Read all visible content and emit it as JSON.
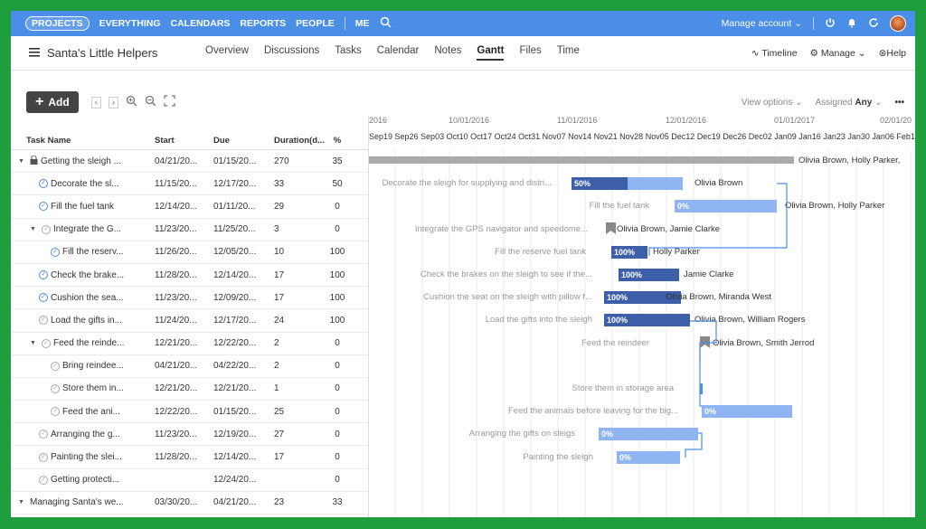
{
  "topnav": {
    "items": [
      "PROJECTS",
      "EVERYTHING",
      "CALENDARS",
      "REPORTS",
      "PEOPLE"
    ],
    "me": "ME",
    "manage_account": "Manage account"
  },
  "project": {
    "title": "Santa's Little Helpers",
    "tabs": [
      "Overview",
      "Discussions",
      "Tasks",
      "Calendar",
      "Notes",
      "Gantt",
      "Files",
      "Time"
    ],
    "active_tab": "Gantt",
    "timeline": "Timeline",
    "manage": "Manage",
    "help": "Help"
  },
  "toolbar": {
    "add_label": "Add",
    "view_options": "View options",
    "assigned_label": "Assigned",
    "assigned_value": "Any"
  },
  "table": {
    "headers": [
      "Task Name",
      "Start",
      "Due",
      "Duration(d...",
      "%"
    ],
    "rows": [
      {
        "name": "Getting the sleigh ...",
        "start": "04/21/20...",
        "due": "01/15/20...",
        "dur": "270",
        "pct": "35"
      },
      {
        "name": "Decorate the sl...",
        "start": "11/15/20...",
        "due": "12/17/20...",
        "dur": "33",
        "pct": "50"
      },
      {
        "name": "Fill the fuel tank",
        "start": "12/14/20...",
        "due": "01/11/20...",
        "dur": "29",
        "pct": "0"
      },
      {
        "name": "Integrate the G...",
        "start": "11/23/20...",
        "due": "11/25/20...",
        "dur": "3",
        "pct": "0"
      },
      {
        "name": "Fill the reserv...",
        "start": "11/26/20...",
        "due": "12/05/20...",
        "dur": "10",
        "pct": "100"
      },
      {
        "name": "Check the brake...",
        "start": "11/28/20...",
        "due": "12/14/20...",
        "dur": "17",
        "pct": "100"
      },
      {
        "name": "Cushion the sea...",
        "start": "11/23/20...",
        "due": "12/09/20...",
        "dur": "17",
        "pct": "100"
      },
      {
        "name": "Load the gifts in...",
        "start": "11/24/20...",
        "due": "12/17/20...",
        "dur": "24",
        "pct": "100"
      },
      {
        "name": "Feed the reinde...",
        "start": "12/21/20...",
        "due": "12/22/20...",
        "dur": "2",
        "pct": "0"
      },
      {
        "name": "Bring reindee...",
        "start": "04/21/20...",
        "due": "04/22/20...",
        "dur": "2",
        "pct": "0"
      },
      {
        "name": "Store them in...",
        "start": "12/21/20...",
        "due": "12/21/20...",
        "dur": "1",
        "pct": "0"
      },
      {
        "name": "Feed the ani...",
        "start": "12/22/20...",
        "due": "01/15/20...",
        "dur": "25",
        "pct": "0"
      },
      {
        "name": "Arranging the g...",
        "start": "11/23/20...",
        "due": "12/19/20...",
        "dur": "27",
        "pct": "0"
      },
      {
        "name": "Painting the slei...",
        "start": "11/28/20...",
        "due": "12/14/20...",
        "dur": "17",
        "pct": "0"
      },
      {
        "name": "Getting protecti...",
        "start": "",
        "due": "12/24/20...",
        "dur": "",
        "pct": "0"
      },
      {
        "name": "Managing Santa's we...",
        "start": "03/30/20...",
        "due": "04/21/20...",
        "dur": "23",
        "pct": "33"
      }
    ]
  },
  "gantt": {
    "months": [
      "2016",
      "10/01/2016",
      "11/01/2016",
      "12/01/2016",
      "01/01/2017",
      "02/01/20"
    ],
    "weeks": "Sep19 Sep26 Sep03 Oct10 Oct17 Oct24 Oct31 Nov07 Nov14 Nov21 Nov28 Nov05 Dec12 Dec19 Dec26 Dec02 Jan09 Jan16 Jan23 Jan30 Jan06 Feb1",
    "tasks": [
      {
        "label": "",
        "assignee": "Olivia Brown, Holly Parker,",
        "pct": ""
      },
      {
        "label": "Decorate the sleigh for supplying and distri...",
        "assignee": "Olivia Brown",
        "pct": "50%"
      },
      {
        "label": "Fill the fuel tank",
        "assignee": "Olivia Brown, Holly Parker",
        "pct": "0%"
      },
      {
        "label": "Integrate the GPS navigator and speedome...",
        "assignee": "Olivia Brown, Jamie Clarke",
        "pct": ""
      },
      {
        "label": "Fill the reserve fuel tank",
        "assignee": "Holly Parker",
        "pct": "100%"
      },
      {
        "label": "Check the brakes on the sleigh to see if the...",
        "assignee": "Jamie Clarke",
        "pct": "100%"
      },
      {
        "label": "Cushion the seat on the sleigh with pillow f...",
        "assignee": "Olivia Brown, Miranda West",
        "pct": "100%"
      },
      {
        "label": "Load the gifts into the sleigh",
        "assignee": "Olivia Brown, William Rogers",
        "pct": "100%"
      },
      {
        "label": "Feed the reindeer",
        "assignee": "Olivia Brown, Smith Jerrod",
        "pct": ""
      },
      {
        "label": "",
        "assignee": "",
        "pct": ""
      },
      {
        "label": "Store them in storage area",
        "assignee": "",
        "pct": ""
      },
      {
        "label": "Feed the animals before leaving for the big...",
        "assignee": "",
        "pct": "0%"
      },
      {
        "label": "Arranging the gifts on sleigs",
        "assignee": "",
        "pct": "0%"
      },
      {
        "label": "Painting the sleigh",
        "assignee": "",
        "pct": "0%"
      }
    ]
  },
  "colors": {
    "frame": "#1e9e3c",
    "topbar": "#4a8ee8",
    "bar_light": "#8fb4f2",
    "bar_dark": "#3c5fa8"
  }
}
